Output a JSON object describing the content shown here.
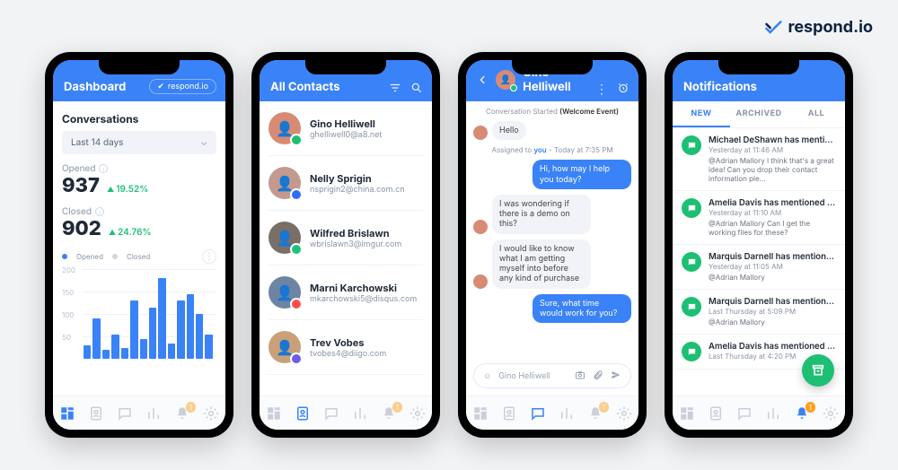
{
  "brand": "respond.io",
  "screens": {
    "dashboard": {
      "title": "Dashboard",
      "logo_chip": "respond.io",
      "section": "Conversations",
      "range": "Last 14 days",
      "kpis": [
        {
          "label": "Opened",
          "value": "937",
          "delta": "19.52%"
        },
        {
          "label": "Closed",
          "value": "902",
          "delta": "24.76%"
        }
      ],
      "legend": {
        "a": "Opened",
        "b": "Closed"
      }
    },
    "contacts": {
      "title": "All Contacts",
      "items": [
        {
          "name": "Gino Helliwell",
          "email": "ghelliwell0@a8.net",
          "color": "#d88b74",
          "badge": "#1dbf73"
        },
        {
          "name": "Nelly Sprigin",
          "email": "nsprigin2@china.com.cn",
          "color": "#c49a8e",
          "badge": "#2f6df6"
        },
        {
          "name": "Wilfred Brislawn",
          "email": "wbrislawn3@imgur.com",
          "color": "#7a6f66",
          "badge": "#19c37d"
        },
        {
          "name": "Marni Karchowski",
          "email": "mkarchowski5@disqus.com",
          "color": "#6d84a3",
          "badge": "#ff4d4d"
        },
        {
          "name": "Trev Vobes",
          "email": "tvobes4@diigo.com",
          "color": "#caa07a",
          "badge": "#6c5ce7"
        }
      ]
    },
    "chat": {
      "title": "Gino Helliwell",
      "events": {
        "started_prefix": "Conversation Started",
        "started_event": "(Welcome Event)",
        "assigned_prefix": "Assigned to",
        "assigned_to": "you",
        "assigned_time": "- Today at 7:35 PM"
      },
      "messages": {
        "m1": "Hello",
        "m2": "Hi, how may I help you today?",
        "m3": "I was wondering if there is a demo on this?",
        "m4": "I would like to know what I am getting myself into before any kind of purchase",
        "m5": "Sure, what time would work for you?"
      },
      "input_placeholder": "Gino Helliwell"
    },
    "notifications": {
      "title": "Notifications",
      "tabs": {
        "new": "NEW",
        "archived": "ARCHIVED",
        "all": "ALL"
      },
      "items": [
        {
          "title": "Michael DeShawn has mentioned you i..",
          "time": "Yesterday at 11:46 AM",
          "body": "@Adrian Mallory I think that's a great idea! Can you drop their contact information ple..."
        },
        {
          "title": "Amelia Davis has mentioned you...",
          "time": "Yesterday at 11:10 AM",
          "body": "@Adrian Mallory Can I get the working files for these?"
        },
        {
          "title": "Marquis Darnell has mentioned you...",
          "time": "Yesterday at 11:05 AM",
          "body": "@Adrian Mallory"
        },
        {
          "title": "Marquis Darnell has mentioned you i..",
          "time": "Last Thursday at 5:09 PM",
          "body": "@Adrian Mallory"
        },
        {
          "title": "Amelia Davis has mentioned you...",
          "time": "Last Thursday at 4:20 PM",
          "body": ""
        }
      ]
    }
  },
  "tabbar_badge": "1",
  "chart_data": {
    "type": "bar",
    "title": "Conversations",
    "ylabel": "",
    "ylim": [
      0,
      200
    ],
    "yticks": [
      50,
      100,
      150,
      200
    ],
    "series_name": "Opened",
    "values": [
      30,
      90,
      20,
      55,
      25,
      130,
      45,
      115,
      180,
      35,
      130,
      145,
      100,
      55
    ]
  }
}
